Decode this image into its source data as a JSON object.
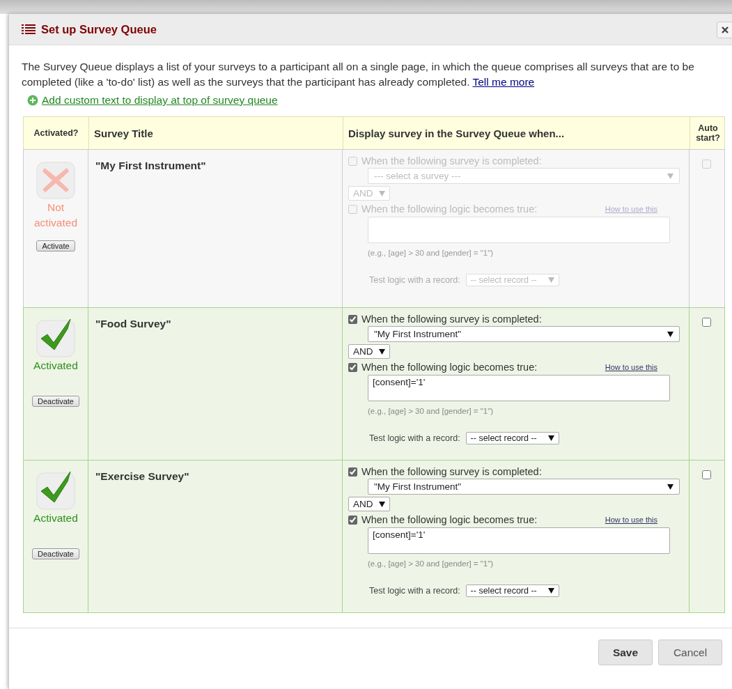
{
  "dialog": {
    "title": "Set up Survey Queue",
    "description": "The Survey Queue displays a list of your surveys to a participant all on a single page, in which the queue comprises all surveys that are to be completed (like a 'to-do' list) as well as the surveys that the participant has already completed.",
    "description_link": "Tell me more",
    "add_custom_text_link": "Add custom text to display at top of survey queue"
  },
  "table": {
    "columns": [
      "Activated?",
      "Survey Title",
      "Display survey in the Survey Queue when...",
      "Auto start?"
    ],
    "rows": [
      {
        "activated": false,
        "status": "Not activated",
        "action": "Activate",
        "title": "\"My First Instrument\"",
        "survey_condition": {
          "checked": false,
          "label": "When the following survey is completed:",
          "value": "--- select a survey ---"
        },
        "operator": "AND",
        "logic_condition": {
          "checked": false,
          "label": "When the following logic becomes true:"
        },
        "help_link": "How to use this",
        "example": "(e.g., [age] > 30 and [gender] = \"1\")",
        "test_label": "Test logic with a record:",
        "test_record": "-- select record --",
        "auto_start": false
      },
      {
        "activated": true,
        "status": "Activated",
        "action": "Deactivate",
        "title": "\"Food Survey\"",
        "survey_condition": {
          "checked": true,
          "label": "When the following survey is completed:",
          "value": "\"My First Instrument\""
        },
        "operator": "AND",
        "logic_condition": {
          "checked": true,
          "label": "When the following logic becomes true:",
          "value": "[consent]='1'"
        },
        "help_link": "How to use this",
        "example": "(e.g., [age] > 30 and [gender] = \"1\")",
        "test_label": "Test logic with a record:",
        "test_record": "-- select record --",
        "auto_start": false
      },
      {
        "activated": true,
        "status": "Activated",
        "action": "Deactivate",
        "title": "\"Exercise Survey\"",
        "survey_condition": {
          "checked": true,
          "label": "When the following survey is completed:",
          "value": "\"My First Instrument\""
        },
        "operator": "AND",
        "logic_condition": {
          "checked": true,
          "label": "When the following logic becomes true:",
          "value": "[consent]='1'"
        },
        "help_link": "How to use this",
        "example": "(e.g., [age] > 30 and [gender] = \"1\")",
        "test_label": "Test logic with a record:",
        "test_record": "-- select record --",
        "auto_start": false
      }
    ]
  },
  "buttons": [
    "Save",
    "Cancel"
  ]
}
